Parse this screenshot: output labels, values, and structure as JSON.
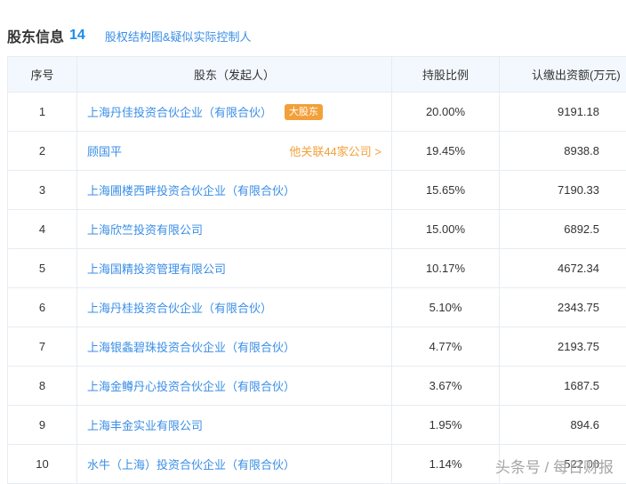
{
  "header": {
    "title": "股东信息",
    "count": "14",
    "link": "股权结构图&疑似实际控制人"
  },
  "table": {
    "columns": [
      "序号",
      "股东（发起人）",
      "持股比例",
      "认缴出资额(万元)"
    ],
    "rows": [
      {
        "idx": "1",
        "name": "上海丹佳投资合伙企业（有限合伙）",
        "badge": "大股东",
        "related": "",
        "pct": "20.00%",
        "amount": "9191.18"
      },
      {
        "idx": "2",
        "name": "顾国平",
        "badge": "",
        "related": "他关联44家公司 >",
        "pct": "19.45%",
        "amount": "8938.8"
      },
      {
        "idx": "3",
        "name": "上海圃楼西畔投资合伙企业（有限合伙）",
        "badge": "",
        "related": "",
        "pct": "15.65%",
        "amount": "7190.33"
      },
      {
        "idx": "4",
        "name": "上海欣竺投资有限公司",
        "badge": "",
        "related": "",
        "pct": "15.00%",
        "amount": "6892.5"
      },
      {
        "idx": "5",
        "name": "上海国精投资管理有限公司",
        "badge": "",
        "related": "",
        "pct": "10.17%",
        "amount": "4672.34"
      },
      {
        "idx": "6",
        "name": "上海丹桂投资合伙企业（有限合伙）",
        "badge": "",
        "related": "",
        "pct": "5.10%",
        "amount": "2343.75"
      },
      {
        "idx": "7",
        "name": "上海银螽碧珠投资合伙企业（有限合伙）",
        "badge": "",
        "related": "",
        "pct": "4.77%",
        "amount": "2193.75"
      },
      {
        "idx": "8",
        "name": "上海金鳟丹心投资合伙企业（有限合伙）",
        "badge": "",
        "related": "",
        "pct": "3.67%",
        "amount": "1687.5"
      },
      {
        "idx": "9",
        "name": "上海丰金实业有限公司",
        "badge": "",
        "related": "",
        "pct": "1.95%",
        "amount": "894.6"
      },
      {
        "idx": "10",
        "name": "水牛（上海）投资合伙企业（有限合伙）",
        "badge": "",
        "related": "",
        "pct": "1.14%",
        "amount": "522.00"
      }
    ]
  },
  "watermark": "头条号 / 每日财报"
}
